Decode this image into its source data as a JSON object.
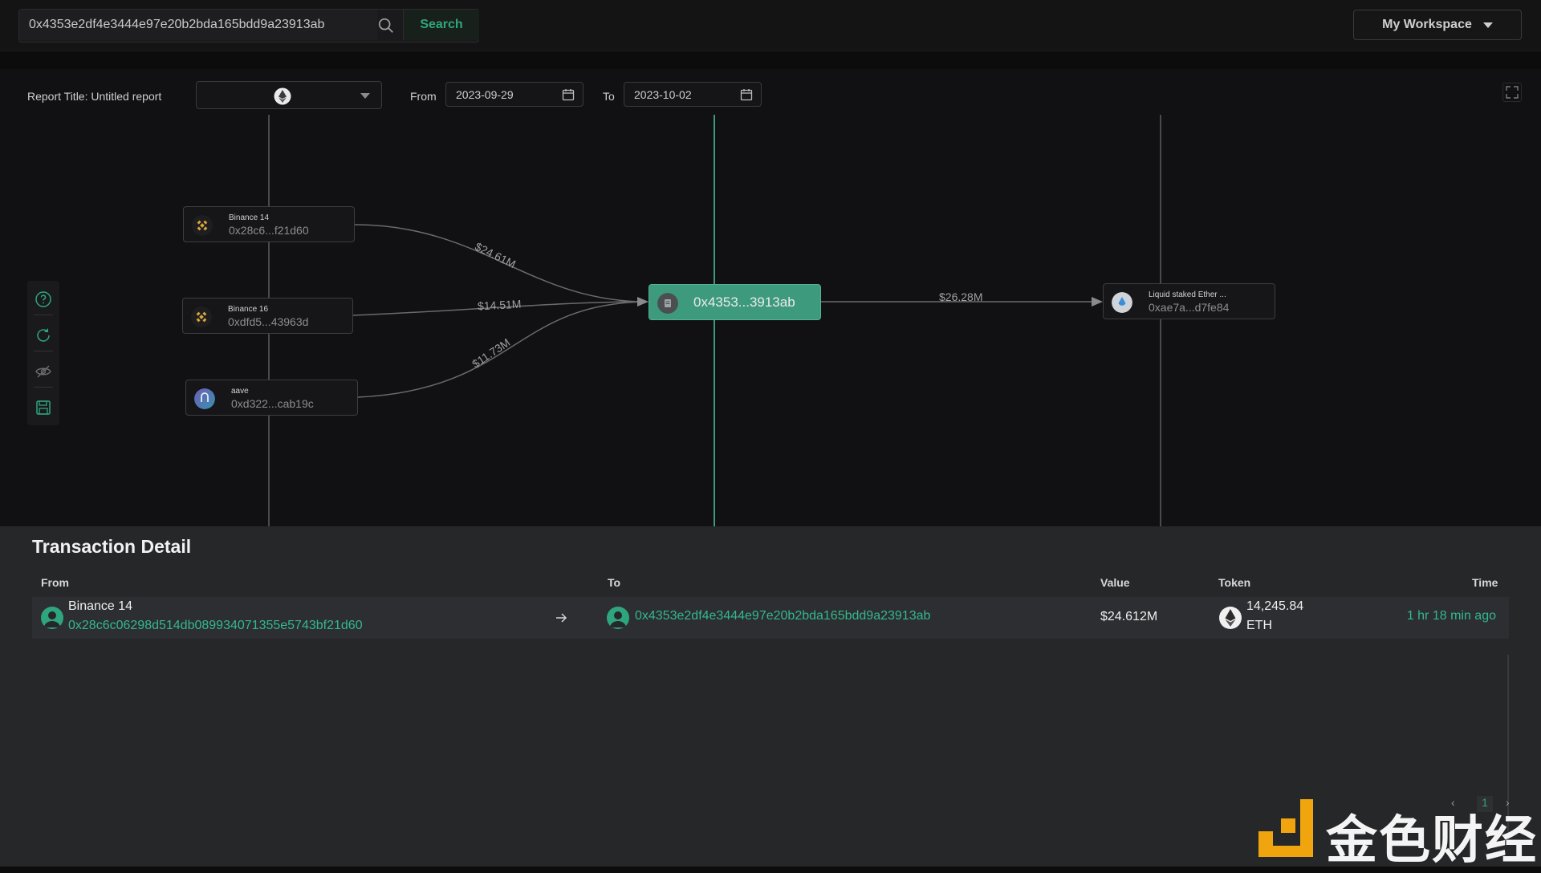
{
  "search": {
    "value": "0x4353e2df4e3444e97e20b2bda165bdd9a23913ab",
    "button_label": "Search"
  },
  "workspace": {
    "label": "My Workspace"
  },
  "report": {
    "title_label": "Report Title: Untitled report",
    "chain_icon": "ethereum-icon",
    "from_label": "From",
    "from_date": "2023-09-29",
    "to_label": "To",
    "to_date": "2023-10-02"
  },
  "graph": {
    "nodes": [
      {
        "name": "Binance 14",
        "address": "0x28c6...f21d60",
        "icon": "binance-icon"
      },
      {
        "name": "Binance 16",
        "address": "0xdfd5...43963d",
        "icon": "binance-icon"
      },
      {
        "name": "aave",
        "address": "0xd322...cab19c",
        "icon": "aave-icon"
      },
      {
        "name": "",
        "address": "0x4353...3913ab",
        "icon": "contract-icon"
      },
      {
        "name": "Liquid staked Ether ...",
        "address": "0xae7a...d7fe84",
        "icon": "steth-icon"
      }
    ],
    "edges": [
      {
        "label": "$24.61M"
      },
      {
        "label": "$14.51M"
      },
      {
        "label": "$11.73M"
      },
      {
        "label": "$26.28M"
      }
    ]
  },
  "toolbar": {
    "icons": [
      "help-icon",
      "refresh-icon",
      "hide-icon",
      "save-icon"
    ]
  },
  "detail": {
    "title": "Transaction Detail",
    "columns": {
      "from": "From",
      "to": "To",
      "value": "Value",
      "token": "Token",
      "time": "Time"
    },
    "rows": [
      {
        "from_name": "Binance 14",
        "from_address": "0x28c6c06298d514db089934071355e5743bf21d60",
        "to_address": "0x4353e2df4e3444e97e20b2bda165bdd9a23913ab",
        "value": "$24.612M",
        "token_amount": "14,245.84",
        "token_symbol": "ETH",
        "time": "1 hr 18 min ago"
      }
    ],
    "page": "1"
  },
  "watermark": {
    "text": "金色财经"
  },
  "colors": {
    "accent": "#2fa57e",
    "center_node": "#3e9a7c",
    "background": "#111113",
    "panel": "#262729"
  }
}
